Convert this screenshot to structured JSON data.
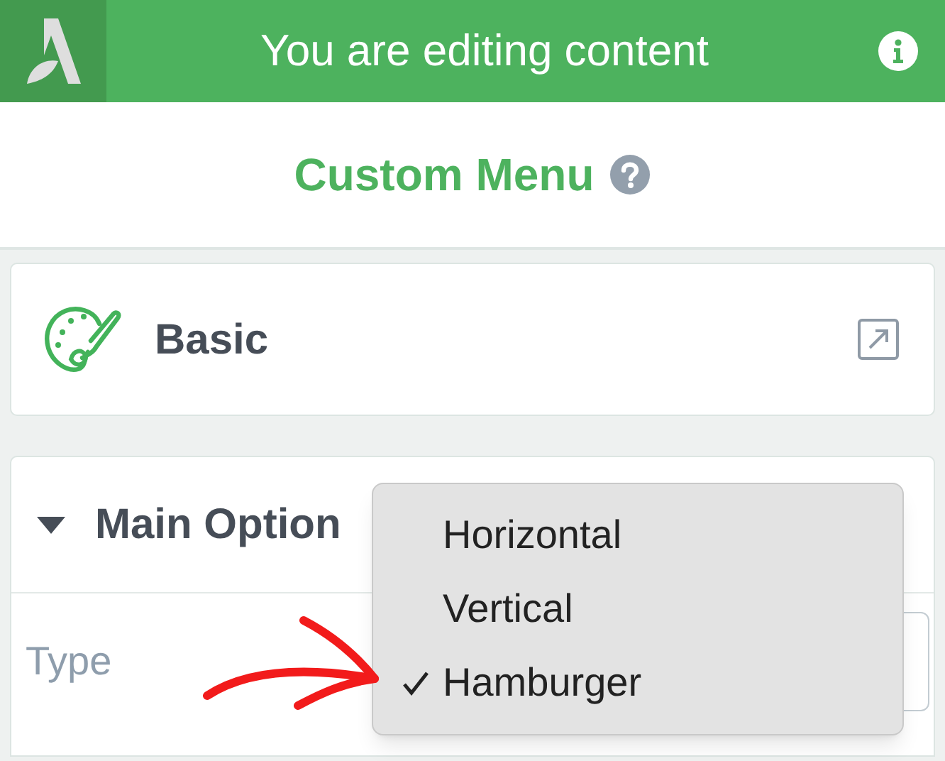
{
  "header": {
    "title": "You are editing content"
  },
  "panel": {
    "title": "Custom Menu"
  },
  "sections": [
    {
      "title": "Basic",
      "kind": "link"
    },
    {
      "title": "Main Option",
      "kind": "collapsible",
      "expanded": true,
      "fields": [
        {
          "label": "Type"
        }
      ]
    }
  ],
  "dropdown": {
    "options": [
      {
        "label": "Horizontal",
        "selected": false
      },
      {
        "label": "Vertical",
        "selected": false
      },
      {
        "label": "Hamburger",
        "selected": true
      }
    ]
  }
}
